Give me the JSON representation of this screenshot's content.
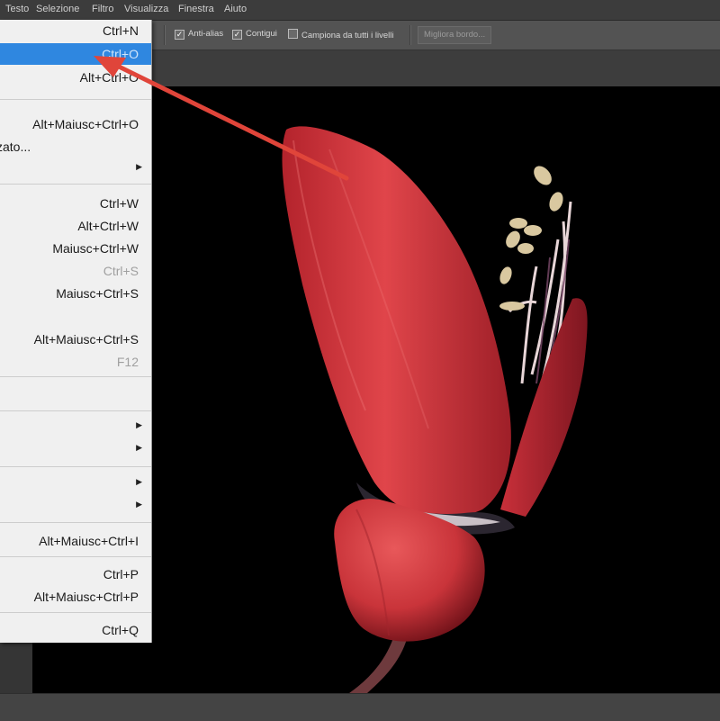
{
  "menubar": {
    "items": [
      "Testo",
      "Selezione",
      "Filtro",
      "Visualizza",
      "Finestra",
      "Aiuto"
    ]
  },
  "options": {
    "anti_alias": "Anti-alias",
    "contiguous": "Contigui",
    "sample_all": "Campiona da tutti i livelli",
    "refine_edge": "Migliora bordo..."
  },
  "file_menu": {
    "items": [
      {
        "shortcut": "Ctrl+N"
      },
      {
        "shortcut": "Ctrl+O",
        "highlighted": true
      },
      {
        "shortcut": "Alt+Ctrl+O"
      },
      {
        "shortcut": "Alt+Maiusc+Ctrl+O"
      },
      {
        "label": "zato..."
      },
      {
        "submenu": true
      },
      {
        "shortcut": "Ctrl+W"
      },
      {
        "shortcut": "Alt+Ctrl+W"
      },
      {
        "shortcut": "Maiusc+Ctrl+W"
      },
      {
        "shortcut": "Ctrl+S",
        "disabled": true
      },
      {
        "shortcut": "Maiusc+Ctrl+S"
      },
      {
        "shortcut": "Alt+Maiusc+Ctrl+S"
      },
      {
        "shortcut": "F12",
        "disabled": true
      },
      {
        "submenu": true
      },
      {
        "submenu": true
      },
      {
        "submenu": true
      },
      {
        "submenu": true
      },
      {
        "shortcut": "Alt+Maiusc+Ctrl+I"
      },
      {
        "shortcut": "Ctrl+P"
      },
      {
        "shortcut": "Alt+Maiusc+Ctrl+P"
      },
      {
        "shortcut": "Ctrl+Q"
      }
    ]
  },
  "icons": {
    "submenu": "chevron-right-icon",
    "annotation": "red-arrow-icon"
  },
  "colors": {
    "highlight": "#2f87e0",
    "annotation_arrow": "#e0453a",
    "petal": "#d8353c"
  }
}
